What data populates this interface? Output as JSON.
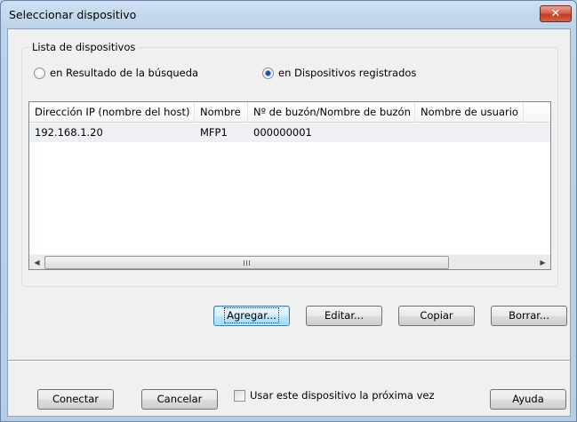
{
  "window": {
    "title": "Seleccionar dispositivo",
    "close_glyph": "✕"
  },
  "group": {
    "legend": "Lista de dispositivos",
    "radio_search": "en Resultado de la búsqueda",
    "radio_registered": "en Dispositivos registrados",
    "selected_radio": "registered"
  },
  "list": {
    "columns": [
      "Dirección IP (nombre del host)",
      "Nombre",
      "Nº de buzón/Nombre de buzón",
      "Nombre de usuario"
    ],
    "rows": [
      [
        "192.168.1.20",
        "MFP1",
        "000000001",
        ""
      ]
    ],
    "scroll_left": "◀",
    "scroll_right": "▶"
  },
  "actions": {
    "add": "Agregar...",
    "edit": "Editar...",
    "copy": "Copiar",
    "delete": "Borrar..."
  },
  "footer": {
    "connect": "Conectar",
    "cancel": "Cancelar",
    "use_next_time": "Usar este dispositivo la próxima vez",
    "use_next_time_checked": false,
    "help": "Ayuda"
  }
}
